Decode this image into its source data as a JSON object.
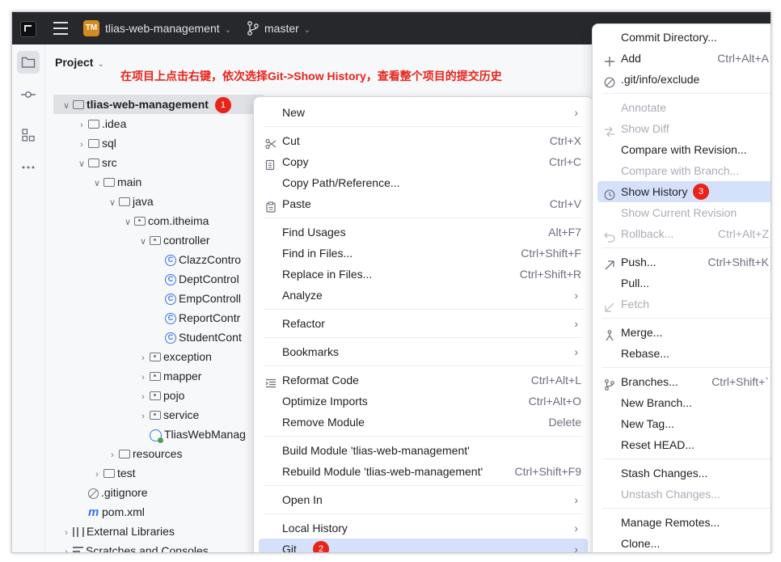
{
  "window": {
    "project_badge": "TM",
    "project_name": "tlias-web-management",
    "branch": "master"
  },
  "project_panel": {
    "title": "Project",
    "annotation": "在项目上点击右键，依次选择Git->Show History，查看整个项目的提交历史",
    "tree": [
      {
        "label": "tlias-web-management",
        "depth": 0,
        "twisty": "open",
        "icon": "module-folder",
        "bold": true,
        "badge": "1"
      },
      {
        "label": ".idea",
        "depth": 1,
        "twisty": "closed",
        "icon": "folder"
      },
      {
        "label": "sql",
        "depth": 1,
        "twisty": "closed",
        "icon": "folder"
      },
      {
        "label": "src",
        "depth": 1,
        "twisty": "open",
        "icon": "folder"
      },
      {
        "label": "main",
        "depth": 2,
        "twisty": "open",
        "icon": "folder"
      },
      {
        "label": "java",
        "depth": 3,
        "twisty": "open",
        "icon": "source-folder"
      },
      {
        "label": "com.itheima",
        "depth": 4,
        "twisty": "open",
        "icon": "package"
      },
      {
        "label": "controller",
        "depth": 5,
        "twisty": "open",
        "icon": "package"
      },
      {
        "label": "ClazzContro",
        "depth": 6,
        "twisty": "none",
        "icon": "class"
      },
      {
        "label": "DeptControl",
        "depth": 6,
        "twisty": "none",
        "icon": "class"
      },
      {
        "label": "EmpControll",
        "depth": 6,
        "twisty": "none",
        "icon": "class"
      },
      {
        "label": "ReportContr",
        "depth": 6,
        "twisty": "none",
        "icon": "class"
      },
      {
        "label": "StudentCont",
        "depth": 6,
        "twisty": "none",
        "icon": "class"
      },
      {
        "label": "exception",
        "depth": 5,
        "twisty": "closed",
        "icon": "package"
      },
      {
        "label": "mapper",
        "depth": 5,
        "twisty": "closed",
        "icon": "package"
      },
      {
        "label": "pojo",
        "depth": 5,
        "twisty": "closed",
        "icon": "package"
      },
      {
        "label": "service",
        "depth": 5,
        "twisty": "closed",
        "icon": "package"
      },
      {
        "label": "TliasWebManag",
        "depth": 5,
        "twisty": "none",
        "icon": "app-class"
      },
      {
        "label": "resources",
        "depth": 3,
        "twisty": "closed",
        "icon": "resources-folder"
      },
      {
        "label": "test",
        "depth": 2,
        "twisty": "closed",
        "icon": "folder"
      },
      {
        "label": ".gitignore",
        "depth": 1,
        "twisty": "none",
        "icon": "ignore-file"
      },
      {
        "label": "pom.xml",
        "depth": 1,
        "twisty": "none",
        "icon": "maven"
      },
      {
        "label": "External Libraries",
        "depth": 0,
        "twisty": "closed",
        "icon": "libraries"
      },
      {
        "label": "Scratches and Consoles",
        "depth": 0,
        "twisty": "closed",
        "icon": "scratches"
      }
    ]
  },
  "context_menu": {
    "items": [
      {
        "label": "New",
        "arrow": true
      },
      {
        "sep": true
      },
      {
        "label": "Cut",
        "shortcut": "Ctrl+X",
        "icon": "scissors-icon"
      },
      {
        "label": "Copy",
        "shortcut": "Ctrl+C",
        "icon": "copy-icon"
      },
      {
        "label": "Copy Path/Reference..."
      },
      {
        "label": "Paste",
        "shortcut": "Ctrl+V",
        "icon": "paste-icon"
      },
      {
        "sep": true
      },
      {
        "label": "Find Usages",
        "shortcut": "Alt+F7"
      },
      {
        "label": "Find in Files...",
        "shortcut": "Ctrl+Shift+F"
      },
      {
        "label": "Replace in Files...",
        "shortcut": "Ctrl+Shift+R"
      },
      {
        "label": "Analyze",
        "arrow": true
      },
      {
        "sep": true
      },
      {
        "label": "Refactor",
        "arrow": true
      },
      {
        "sep": true
      },
      {
        "label": "Bookmarks",
        "arrow": true
      },
      {
        "sep": true
      },
      {
        "label": "Reformat Code",
        "shortcut": "Ctrl+Alt+L",
        "icon": "reformat-icon"
      },
      {
        "label": "Optimize Imports",
        "shortcut": "Ctrl+Alt+O"
      },
      {
        "label": "Remove Module",
        "shortcut": "Delete"
      },
      {
        "sep": true
      },
      {
        "label": "Build Module 'tlias-web-management'"
      },
      {
        "label": "Rebuild Module 'tlias-web-management'",
        "shortcut": "Ctrl+Shift+F9"
      },
      {
        "sep": true
      },
      {
        "label": "Open In",
        "arrow": true
      },
      {
        "sep": true
      },
      {
        "label": "Local History",
        "arrow": true
      },
      {
        "label": "Git",
        "arrow": true,
        "highlight": true,
        "badge": "2"
      }
    ]
  },
  "git_submenu": {
    "items": [
      {
        "label": "Commit Directory..."
      },
      {
        "label": "Add",
        "shortcut": "Ctrl+Alt+A",
        "icon": "plus-icon"
      },
      {
        "label": ".git/info/exclude",
        "icon": "ignore-icon"
      },
      {
        "sep": true
      },
      {
        "label": "Annotate",
        "disabled": true
      },
      {
        "label": "Show Diff",
        "disabled": true,
        "icon": "diff-icon"
      },
      {
        "label": "Compare with Revision..."
      },
      {
        "label": "Compare with Branch...",
        "disabled": true
      },
      {
        "label": "Show History",
        "icon": "clock-icon",
        "highlight": true,
        "badge": "3"
      },
      {
        "label": "Show Current Revision",
        "disabled": true
      },
      {
        "label": "Rollback...",
        "shortcut": "Ctrl+Alt+Z",
        "disabled": true,
        "icon": "rollback-icon"
      },
      {
        "sep": true
      },
      {
        "label": "Push...",
        "shortcut": "Ctrl+Shift+K",
        "icon": "push-icon"
      },
      {
        "label": "Pull..."
      },
      {
        "label": "Fetch",
        "disabled": true,
        "icon": "fetch-icon"
      },
      {
        "sep": true
      },
      {
        "label": "Merge...",
        "icon": "merge-icon"
      },
      {
        "label": "Rebase..."
      },
      {
        "sep": true
      },
      {
        "label": "Branches...",
        "shortcut": "Ctrl+Shift+`",
        "icon": "branch-icon"
      },
      {
        "label": "New Branch..."
      },
      {
        "label": "New Tag..."
      },
      {
        "label": "Reset HEAD..."
      },
      {
        "sep": true
      },
      {
        "label": "Stash Changes..."
      },
      {
        "label": "Unstash Changes...",
        "disabled": true
      },
      {
        "sep": true
      },
      {
        "label": "Manage Remotes..."
      },
      {
        "label": "Clone..."
      }
    ]
  }
}
